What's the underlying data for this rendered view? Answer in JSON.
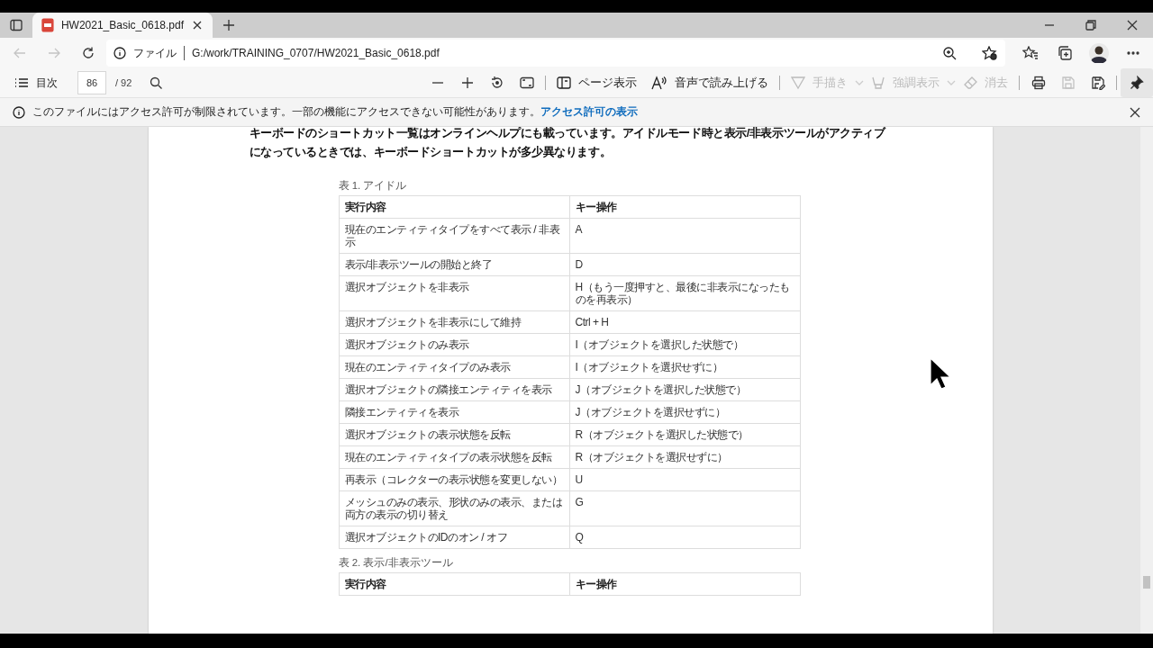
{
  "tab": {
    "title": "HW2021_Basic_0618.pdf",
    "selected": true
  },
  "address": {
    "scheme": "ファイル",
    "url": "G:/work/TRAINING_0707/HW2021_Basic_0618.pdf"
  },
  "pdf_toolbar": {
    "toc_label": "目次",
    "page": "86",
    "page_total": "/ 92",
    "tools": [
      {
        "kind": "view",
        "label": "ページ表示",
        "disabled": false
      },
      {
        "kind": "read",
        "label": "音声で読み上げる",
        "disabled": false
      },
      {
        "kind": "draw",
        "label": "手描き",
        "disabled": true
      },
      {
        "kind": "highlight",
        "label": "強調表示",
        "disabled": true
      },
      {
        "kind": "erase",
        "label": "消去",
        "disabled": true
      }
    ],
    "icon_tools": [
      {
        "kind": "print",
        "disabled": false
      },
      {
        "kind": "save",
        "disabled": true
      },
      {
        "kind": "save-as",
        "disabled": false
      },
      {
        "kind": "pin",
        "selected": true
      }
    ]
  },
  "info_bar": {
    "message": "このファイルにはアクセス許可が制限されています。一部の機能にアクセスできない可能性があります。",
    "link": "アクセス許可の表示"
  },
  "document": {
    "paragraph": "キーボードのショートカット一覧はオンラインヘルプにも載っています。アイドルモード時と表示/非表示ツールがアクティブになっているときでは、キーボードショートカットが多少異なります。",
    "tables": [
      {
        "caption": "表 1. アイドル",
        "columns": [
          "実行内容",
          "キー操作"
        ],
        "rows": [
          [
            "現在のエンティティタイプをすべて表示 / 非表示",
            "A"
          ],
          [
            "表示/非表示ツールの開始と終了",
            "D"
          ],
          [
            "選択オブジェクトを非表示",
            "H（もう一度押すと、最後に非表示になったものを再表示）"
          ],
          [
            "選択オブジェクトを非表示にして維持",
            "Ctrl + H"
          ],
          [
            "選択オブジェクトのみ表示",
            "I（オブジェクトを選択した状態で）"
          ],
          [
            "現在のエンティティタイプのみ表示",
            "I（オブジェクトを選択せずに）"
          ],
          [
            "選択オブジェクトの隣接エンティティを表示",
            "J（オブジェクトを選択した状態で）"
          ],
          [
            "隣接エンティティを表示",
            "J（オブジェクトを選択せずに）"
          ],
          [
            "選択オブジェクトの表示状態を反転",
            "R（オブジェクトを選択した状態で）"
          ],
          [
            "現在のエンティティタイプの表示状態を反転",
            "R（オブジェクトを選択せずに）"
          ],
          [
            "再表示（コレクターの表示状態を変更しない）",
            "U"
          ],
          [
            "メッシュのみの表示、形状のみの表示、または両方の表示の切り替え",
            "G"
          ],
          [
            "選択オブジェクトのIDのオン / オフ",
            "Q"
          ]
        ]
      },
      {
        "caption": "表 2. 表示/非表示ツール",
        "columns": [
          "実行内容",
          "キー操作"
        ]
      }
    ]
  }
}
